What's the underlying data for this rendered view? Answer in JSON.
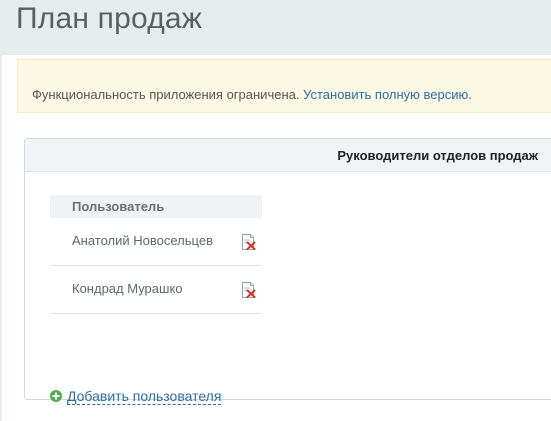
{
  "page": {
    "title": "План продаж"
  },
  "notice": {
    "text": "Функциональность приложения ограничена.",
    "link": "Установить полную версию",
    "link_suffix": "."
  },
  "panel": {
    "title": "Руководители отделов продаж",
    "users_header": "Пользователь",
    "users": [
      {
        "name": "Анатолий Новосельцев",
        "action_icon": "delete-icon"
      },
      {
        "name": "Кондрад Мурашко",
        "action_icon": "delete-icon"
      }
    ],
    "add_user": {
      "icon": "plus-circle-icon",
      "label": "Добавить пользователя"
    }
  },
  "colors": {
    "page_bg": "#e7ecef",
    "notice_bg": "#fcf8e3",
    "link": "#2a6ea8",
    "add_icon": "#4caf50",
    "delete_icon": "#d9302b"
  }
}
